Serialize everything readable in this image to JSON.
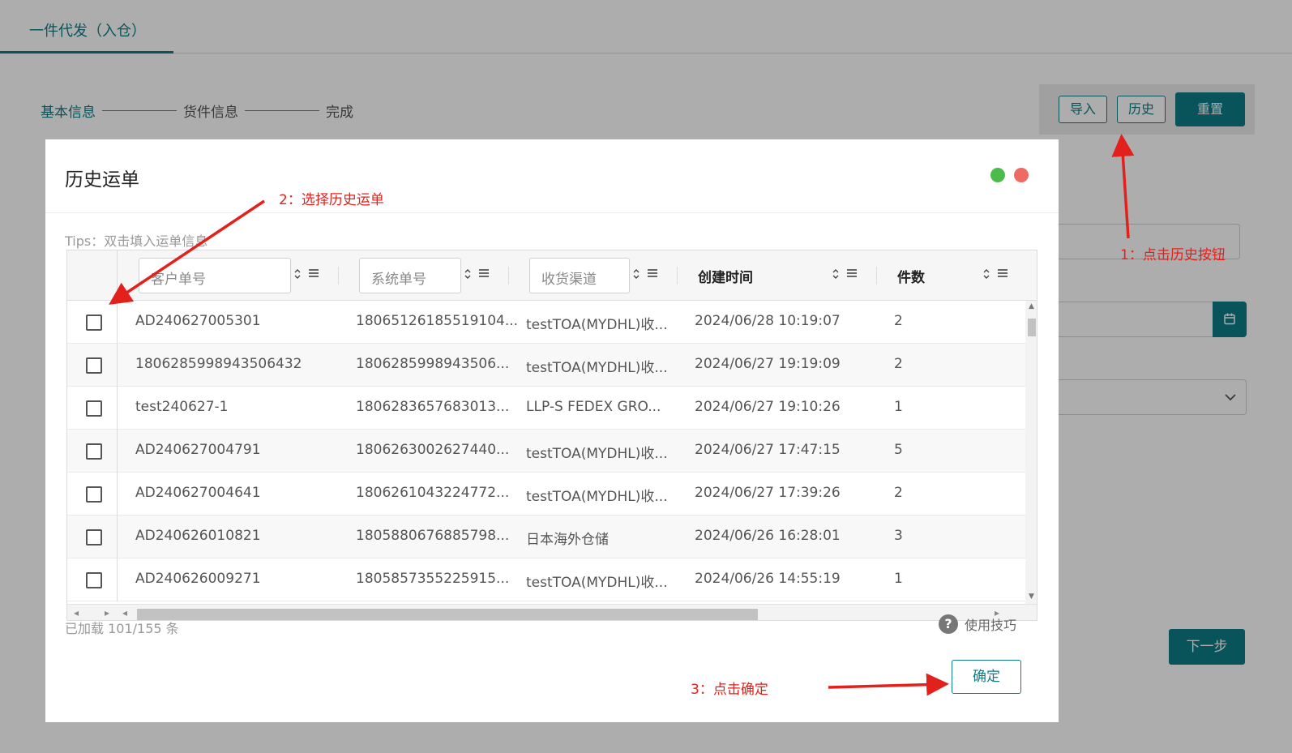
{
  "top_tab": {
    "label": "一件代发（入仓）"
  },
  "steps": {
    "step1": "基本信息",
    "step2": "货件信息",
    "step3": "完成"
  },
  "toolbar": {
    "import_label": "导入",
    "history_label": "历史",
    "reset_label": "重置"
  },
  "next_button": {
    "label": "下一步"
  },
  "modal": {
    "title": "历史运单",
    "tips": "Tips：双击填入运单信息",
    "columns": {
      "customer_no": "客户单号",
      "system_no": "系统单号",
      "channel": "收货渠道",
      "created": "创建时间",
      "pieces": "件数"
    },
    "rows": [
      {
        "customer_no": "AD240627005301",
        "system_no": "18065126185519104...",
        "channel": "testTOA(MYDHL)收...",
        "created": "2024/06/28 10:19:07",
        "pieces": "2"
      },
      {
        "customer_no": "1806285998943506432",
        "system_no": "1806285998943506...",
        "channel": "testTOA(MYDHL)收...",
        "created": "2024/06/27 19:19:09",
        "pieces": "2"
      },
      {
        "customer_no": "test240627-1",
        "system_no": "1806283657683013...",
        "channel": "LLP-S FEDEX GRO...",
        "created": "2024/06/27 19:10:26",
        "pieces": "1"
      },
      {
        "customer_no": "AD240627004791",
        "system_no": "1806263002627440...",
        "channel": "testTOA(MYDHL)收...",
        "created": "2024/06/27 17:47:15",
        "pieces": "5"
      },
      {
        "customer_no": "AD240627004641",
        "system_no": "1806261043224772...",
        "channel": "testTOA(MYDHL)收...",
        "created": "2024/06/27 17:39:26",
        "pieces": "2"
      },
      {
        "customer_no": "AD240626010821",
        "system_no": "1805880676885798...",
        "channel": "日本海外仓储",
        "created": "2024/06/26 16:28:01",
        "pieces": "3"
      },
      {
        "customer_no": "AD240626009271",
        "system_no": "1805857355225915...",
        "channel": "testTOA(MYDHL)收...",
        "created": "2024/06/26 14:55:19",
        "pieces": "1"
      }
    ],
    "loaded_text": "已加载 101/155 条",
    "help_text": "使用技巧",
    "ok_label": "确定"
  },
  "annotations": {
    "step1": "1：点击历史按钮",
    "step2": "2：选择历史运单",
    "step3": "3：点击确定"
  },
  "colors": {
    "accent": "#0e7c86",
    "annotation": "#e2211c",
    "dot_green": "#4cbb4c",
    "dot_red": "#ef6a63"
  }
}
